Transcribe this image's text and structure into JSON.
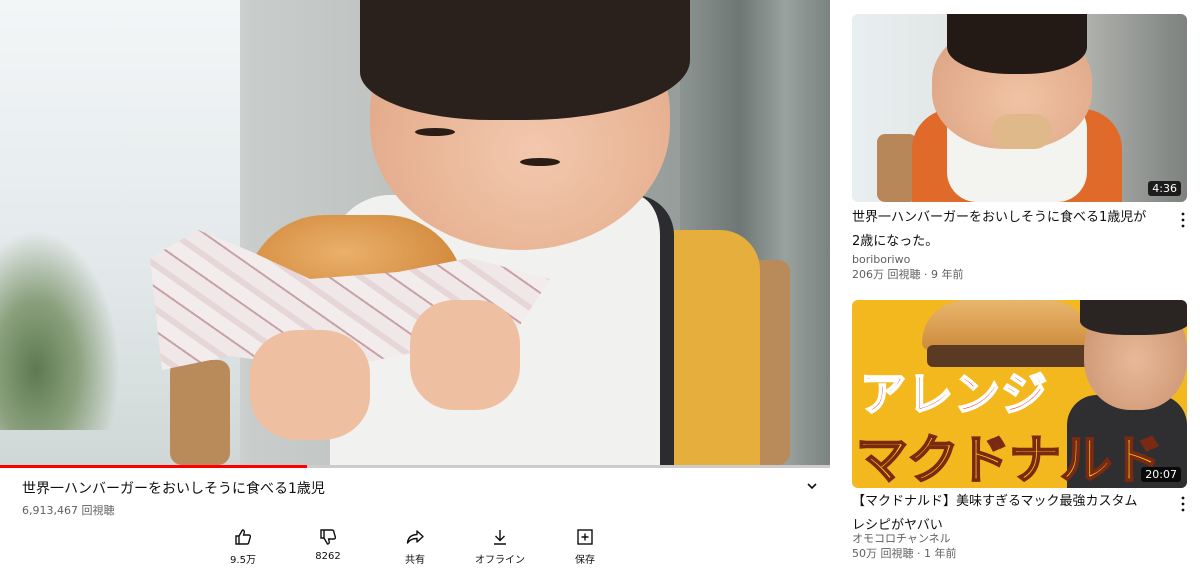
{
  "player": {
    "progress_fraction": 0.37,
    "progress_color": "#ff0000"
  },
  "video": {
    "title": "世界一ハンバーガーをおいしそうに食べる1歳児",
    "views": "6,913,467 回視聴",
    "expand_icon": "chevron-down-icon"
  },
  "actions": [
    {
      "icon": "thumbs-up-icon",
      "label": "9.5万"
    },
    {
      "icon": "thumbs-down-icon",
      "label": "8262"
    },
    {
      "icon": "share-icon",
      "label": "共有"
    },
    {
      "icon": "download-icon",
      "label": "オフライン"
    },
    {
      "icon": "save-playlist-icon",
      "label": "保存"
    }
  ],
  "recommendations": [
    {
      "duration": "4:36",
      "title_line1": "世界一ハンバーガーをおいしそうに食べる1歳児が",
      "title_line2": "2歳になった。",
      "channel": "boriboriwo",
      "meta": "206万 回視聴 · 9 年前"
    },
    {
      "duration": "20:07",
      "thumb_text_1": "アレンジ",
      "thumb_text_2": "マクドナルド",
      "title_line1": "【マクドナルド】美味すぎるマック最強カスタム",
      "title_line2": "レシピがヤバい",
      "channel": "オモコロチャンネル",
      "meta": "50万 回視聴 · 1 年前"
    }
  ],
  "colors": {
    "text_primary": "#0f0f0f",
    "text_secondary": "#606060",
    "accent_red": "#ff0000"
  }
}
